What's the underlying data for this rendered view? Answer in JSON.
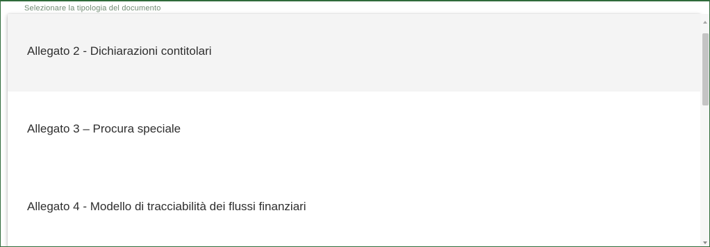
{
  "field": {
    "label": "Selezionare la tipologia del documento"
  },
  "dropdown": {
    "selected_index": 0,
    "options": [
      {
        "label": "Allegato 2 - Dichiarazioni contitolari"
      },
      {
        "label": "Allegato 3 – Procura speciale"
      },
      {
        "label": "Allegato 4 - Modello di tracciabilità dei flussi finanziari"
      }
    ]
  },
  "colors": {
    "frame_border": "#2f6b3a",
    "selected_option_bg": "#f4f4f4",
    "option_text": "#2e2e2e",
    "label_text": "#6f8a72"
  },
  "icons": {
    "scroll_up": "scroll-up-arrow-icon",
    "scroll_down": "scroll-down-arrow-icon"
  }
}
